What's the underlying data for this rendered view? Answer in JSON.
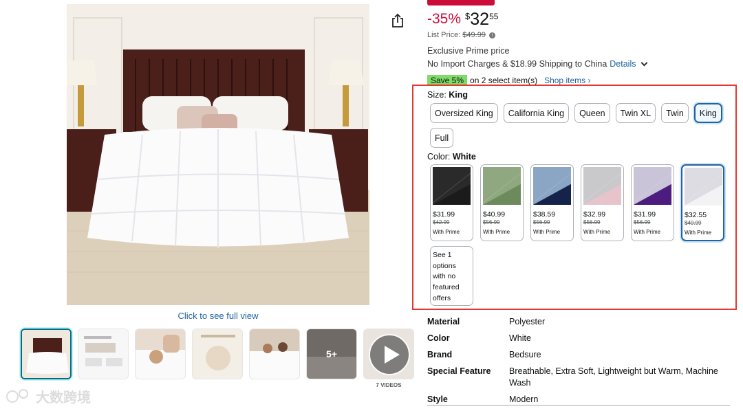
{
  "product": {
    "discount": "-35%",
    "currency": "$",
    "price_whole": "32",
    "price_fraction": "55",
    "list_price_label": "List Price:",
    "list_price": "$49.99",
    "exclusive": "Exclusive Prime price",
    "shipping": "No Import Charges & $18.99 Shipping to China",
    "details_link": "Details",
    "save_badge": "Save 5%",
    "save_text": "on 2 select item(s)",
    "shop_items": "Shop items ›",
    "full_view": "Click to see full view"
  },
  "size": {
    "label": "Size:",
    "selected": "King",
    "options": [
      "Oversized King",
      "California King",
      "Queen",
      "Twin XL",
      "Twin",
      "King",
      "Full"
    ]
  },
  "color": {
    "label": "Color:",
    "selected": "White",
    "options": [
      {
        "name": "Black",
        "price": "$31.99",
        "was": "$42.99",
        "note": "With Prime",
        "c1": "#1b1b1b",
        "c2": "#2a2a2a"
      },
      {
        "name": "Sage",
        "price": "$40.99",
        "was": "$56.99",
        "note": "With Prime",
        "c1": "#6d8a5c",
        "c2": "#8fa87f"
      },
      {
        "name": "Navy",
        "price": "$38.59",
        "was": "$56.99",
        "note": "With Prime",
        "c1": "#15224a",
        "c2": "#8aa6c4"
      },
      {
        "name": "Pink",
        "price": "$32.99",
        "was": "$56.99",
        "note": "With Prime",
        "c1": "#e7c4cc",
        "c2": "#c9c9cc"
      },
      {
        "name": "Purple",
        "price": "$31.99",
        "was": "$56.99",
        "note": "With Prime",
        "c1": "#4c1c7e",
        "c2": "#c9c4d8"
      },
      {
        "name": "White",
        "price": "$32.55",
        "was": "$49.99",
        "note": "With Prime",
        "c1": "#f3f3f5",
        "c2": "#dcdce2"
      }
    ],
    "see_more": "See 1 options with no featured offers"
  },
  "specs": [
    {
      "key": "Material",
      "value": "Polyester"
    },
    {
      "key": "Color",
      "value": "White"
    },
    {
      "key": "Brand",
      "value": "Bedsure"
    },
    {
      "key": "Special Feature",
      "value": "Breathable, Extra Soft, Lightweight but Warm, Machine Wash"
    },
    {
      "key": "Style",
      "value": "Modern"
    }
  ],
  "thumbnails": {
    "more_label": "5+",
    "video_label": "7 VIDEOS"
  },
  "watermark": "大数跨境"
}
